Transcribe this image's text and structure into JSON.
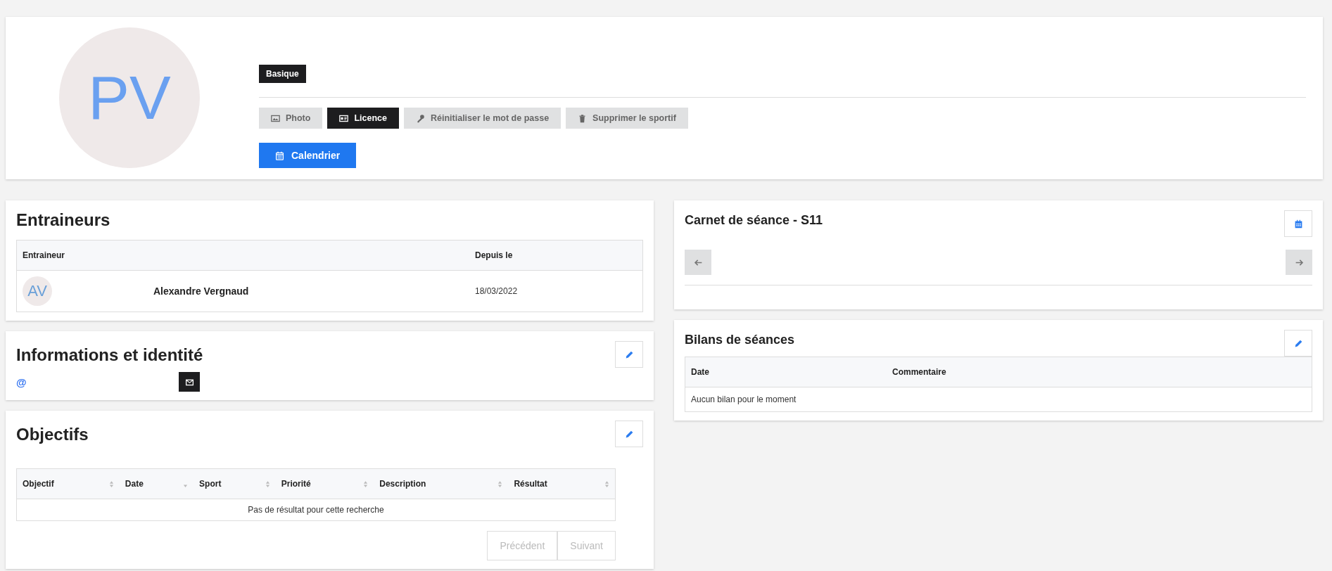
{
  "profile": {
    "initials": "PV",
    "badge": "Basique",
    "actions": [
      {
        "label": "Photo",
        "kind": "image",
        "selected": false
      },
      {
        "label": "Licence",
        "kind": "card",
        "selected": true
      },
      {
        "label": "Réinitialiser le mot de passe",
        "kind": "key",
        "selected": false
      },
      {
        "label": "Supprimer le sportif",
        "kind": "trash",
        "selected": false
      }
    ],
    "calendar_button": "Calendrier"
  },
  "coaches": {
    "title": "Entraineurs",
    "columns": [
      "Entraineur",
      "Depuis le"
    ],
    "rows": [
      {
        "initials": "AV",
        "name": "Alexandre Vergnaud",
        "since": "18/03/2022"
      }
    ]
  },
  "identity": {
    "title": "Informations et identité",
    "email_symbol": "@"
  },
  "goals": {
    "title": "Objectifs",
    "columns": [
      {
        "label": "Objectif",
        "sorted": false
      },
      {
        "label": "Date",
        "sorted": true
      },
      {
        "label": "Sport",
        "sorted": false
      },
      {
        "label": "Priorité",
        "sorted": false
      },
      {
        "label": "Description",
        "sorted": false
      },
      {
        "label": "Résultat",
        "sorted": false
      }
    ],
    "empty": "Pas de résultat pour cette recherche",
    "prev": "Précédent",
    "next": "Suivant"
  },
  "logbook": {
    "title": "Carnet de séance - S11"
  },
  "reviews": {
    "title": "Bilans de séances",
    "columns": [
      "Date",
      "Commentaire"
    ],
    "empty": "Aucun bilan pour le moment"
  }
}
